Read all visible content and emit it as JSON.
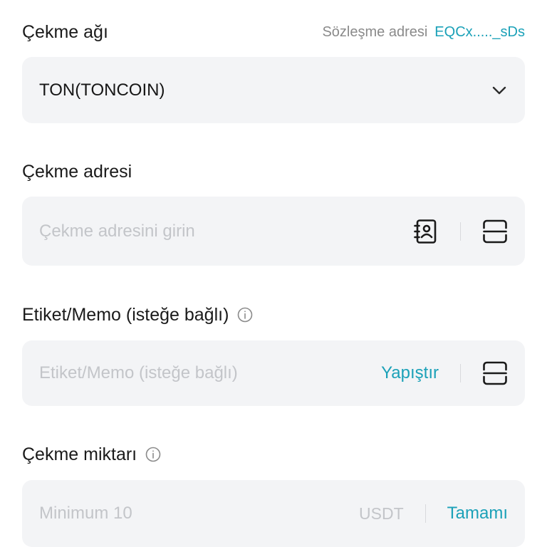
{
  "network": {
    "label": "Çekme ağı",
    "contract_label": "Sözleşme adresi",
    "contract_value": "EQCx....._sDs",
    "selected": "TON(TONCOIN)"
  },
  "address": {
    "label": "Çekme adresi",
    "placeholder": "Çekme adresini girin",
    "address_book_icon": "address-book-icon",
    "scan_icon": "scan-icon"
  },
  "memo": {
    "label": "Etiket/Memo (isteğe bağlı)",
    "placeholder": "Etiket/Memo (isteğe bağlı)",
    "paste_label": "Yapıştır",
    "scan_icon": "scan-icon"
  },
  "amount": {
    "label": "Çekme miktarı",
    "placeholder": "Minimum 10",
    "unit": "USDT",
    "max_label": "Tamamı"
  },
  "colors": {
    "accent": "#1ba1b8",
    "field_bg": "#f3f4f6",
    "placeholder": "#c3c5c9"
  }
}
